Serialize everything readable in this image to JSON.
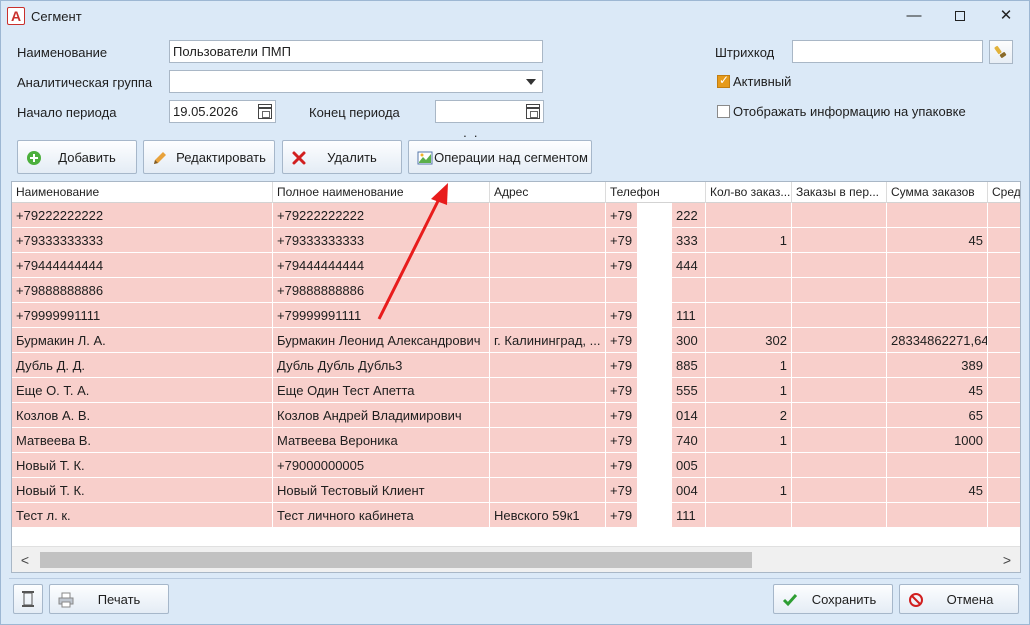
{
  "window": {
    "logo_letter": "A",
    "title": "Сегмент",
    "minimize": "—",
    "close": "✕"
  },
  "form": {
    "name_label": "Наименование",
    "name_value": "Пользователи ПМП",
    "group_label": "Аналитическая группа",
    "group_value": "",
    "start_label": "Начало периода",
    "start_value": "19.05.2026",
    "end_label": "Конец периода",
    "end_value": " .  .",
    "barcode_label": "Штрихкод",
    "barcode_value": "",
    "active_label": "Активный",
    "active_checked": true,
    "packaging_label": "Отображать информацию на упаковке",
    "packaging_checked": false
  },
  "toolbar": {
    "add": "Добавить",
    "edit": "Редактировать",
    "delete": "Удалить",
    "ops": "Операции над сегментом"
  },
  "grid": {
    "columns": [
      "Наименование",
      "Полное наименование",
      "Адрес",
      "Телефон",
      "Кол-во заказ...",
      "Заказы в пер...",
      "Сумма заказов",
      "Сред"
    ],
    "rows": [
      [
        "+79222222222",
        "+79222222222",
        "",
        "+79",
        "222",
        "",
        "",
        ""
      ],
      [
        "+79333333333",
        "+79333333333",
        "",
        "+79",
        "333",
        "1",
        "",
        "45"
      ],
      [
        "+79444444444",
        "+79444444444",
        "",
        "+79",
        "444",
        "",
        "",
        ""
      ],
      [
        "+79888888886",
        "+79888888886",
        "",
        "",
        "",
        "",
        "",
        ""
      ],
      [
        "+79999991111",
        "+79999991111",
        "",
        "+79",
        "111",
        "",
        "",
        ""
      ],
      [
        "Бурмакин Л. А.",
        "Бурмакин Леонид Александрович",
        "г. Калининград, ...",
        "+79",
        "300",
        "302",
        "",
        "28334862271,64"
      ],
      [
        "Дубль Д. Д.",
        "Дубль Дубль Дубль3",
        "",
        "+79",
        "885",
        "1",
        "",
        "389"
      ],
      [
        "Еще О. Т. А.",
        "Еще Один Тест Апетта",
        "",
        "+79",
        "555",
        "1",
        "",
        "45"
      ],
      [
        "Козлов А. В.",
        "Козлов Андрей Владимирович",
        "",
        "+79",
        "014",
        "2",
        "",
        "65"
      ],
      [
        "Матвеева В.",
        "Матвеева Вероника",
        "",
        "+79",
        "740",
        "1",
        "",
        "1000"
      ],
      [
        "Новый Т. К.",
        "+79000000005",
        "",
        "+79",
        "005",
        "",
        "",
        ""
      ],
      [
        "Новый Т. К.",
        "Новый Тестовый Клиент",
        "",
        "+79",
        "004",
        "1",
        "",
        "45"
      ],
      [
        "Тест л. к.",
        "Тест личного кабинета",
        "Невского 59к1",
        "+79",
        "111",
        "",
        "",
        ""
      ]
    ],
    "scroll_left": "<",
    "scroll_right": ">"
  },
  "bottom": {
    "print": "Печать",
    "save": "Сохранить",
    "cancel": "Отмена"
  },
  "colors": {
    "row_bg": "#f8cfcb",
    "window_bg": "#dbe9f7",
    "arrow": "#e81c1c"
  }
}
